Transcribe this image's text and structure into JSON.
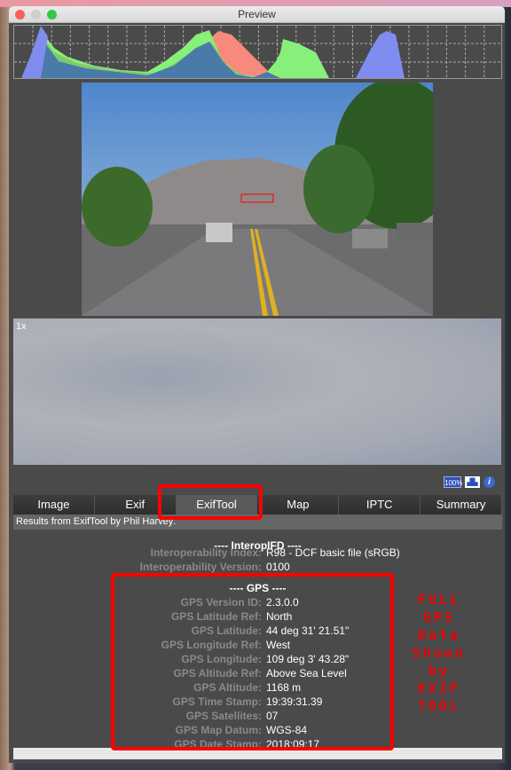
{
  "window": {
    "title": "Preview"
  },
  "zoom_panel": {
    "label": "1x"
  },
  "toolbar_icons": [
    {
      "name": "actual-size-icon",
      "label": "100%"
    },
    {
      "name": "histogram-icon"
    },
    {
      "name": "info-icon",
      "label": "i"
    }
  ],
  "tabs": [
    {
      "label": "Image"
    },
    {
      "label": "Exif"
    },
    {
      "label": "ExifTool",
      "active": true
    },
    {
      "label": "Map"
    },
    {
      "label": "IPTC"
    },
    {
      "label": "Summary"
    }
  ],
  "results_header": "Results from ExifTool by Phil Harvey:",
  "interop": {
    "heading": "---- InteropIFD ----",
    "rows": [
      {
        "label": "Interoperability Index:",
        "value": "R98 - DCF basic file (sRGB)"
      },
      {
        "label": "Interoperability Version:",
        "value": "0100"
      }
    ]
  },
  "gps": {
    "heading": "---- GPS ----",
    "rows": [
      {
        "label": "GPS Version ID:",
        "value": "2.3.0.0"
      },
      {
        "label": "GPS Latitude Ref:",
        "value": "North"
      },
      {
        "label": "GPS Latitude:",
        "value": "44 deg 31' 21.51\""
      },
      {
        "label": "GPS Longitude Ref:",
        "value": "West"
      },
      {
        "label": "GPS Longitude:",
        "value": "109 deg 3' 43.28\""
      },
      {
        "label": "GPS Altitude Ref:",
        "value": "Above Sea Level"
      },
      {
        "label": "GPS Altitude:",
        "value": "1168 m"
      },
      {
        "label": "GPS Time Stamp:",
        "value": "19:39:31.39"
      },
      {
        "label": "GPS Satellites:",
        "value": "07"
      },
      {
        "label": "GPS Map Datum:",
        "value": "WGS-84"
      },
      {
        "label": "GPS Date Stamp:",
        "value": "2018:09:17"
      }
    ]
  },
  "annotation": {
    "lines": [
      "FULL",
      "GPS",
      "Data",
      "Shown",
      "by",
      "EXIF",
      "TOOL"
    ],
    "color": "#ee0000"
  },
  "colors": {
    "highlight": "#ff0000",
    "hist_red": "#f78a7c",
    "hist_green": "#86f07a",
    "hist_blue": "#7f8cf0"
  }
}
